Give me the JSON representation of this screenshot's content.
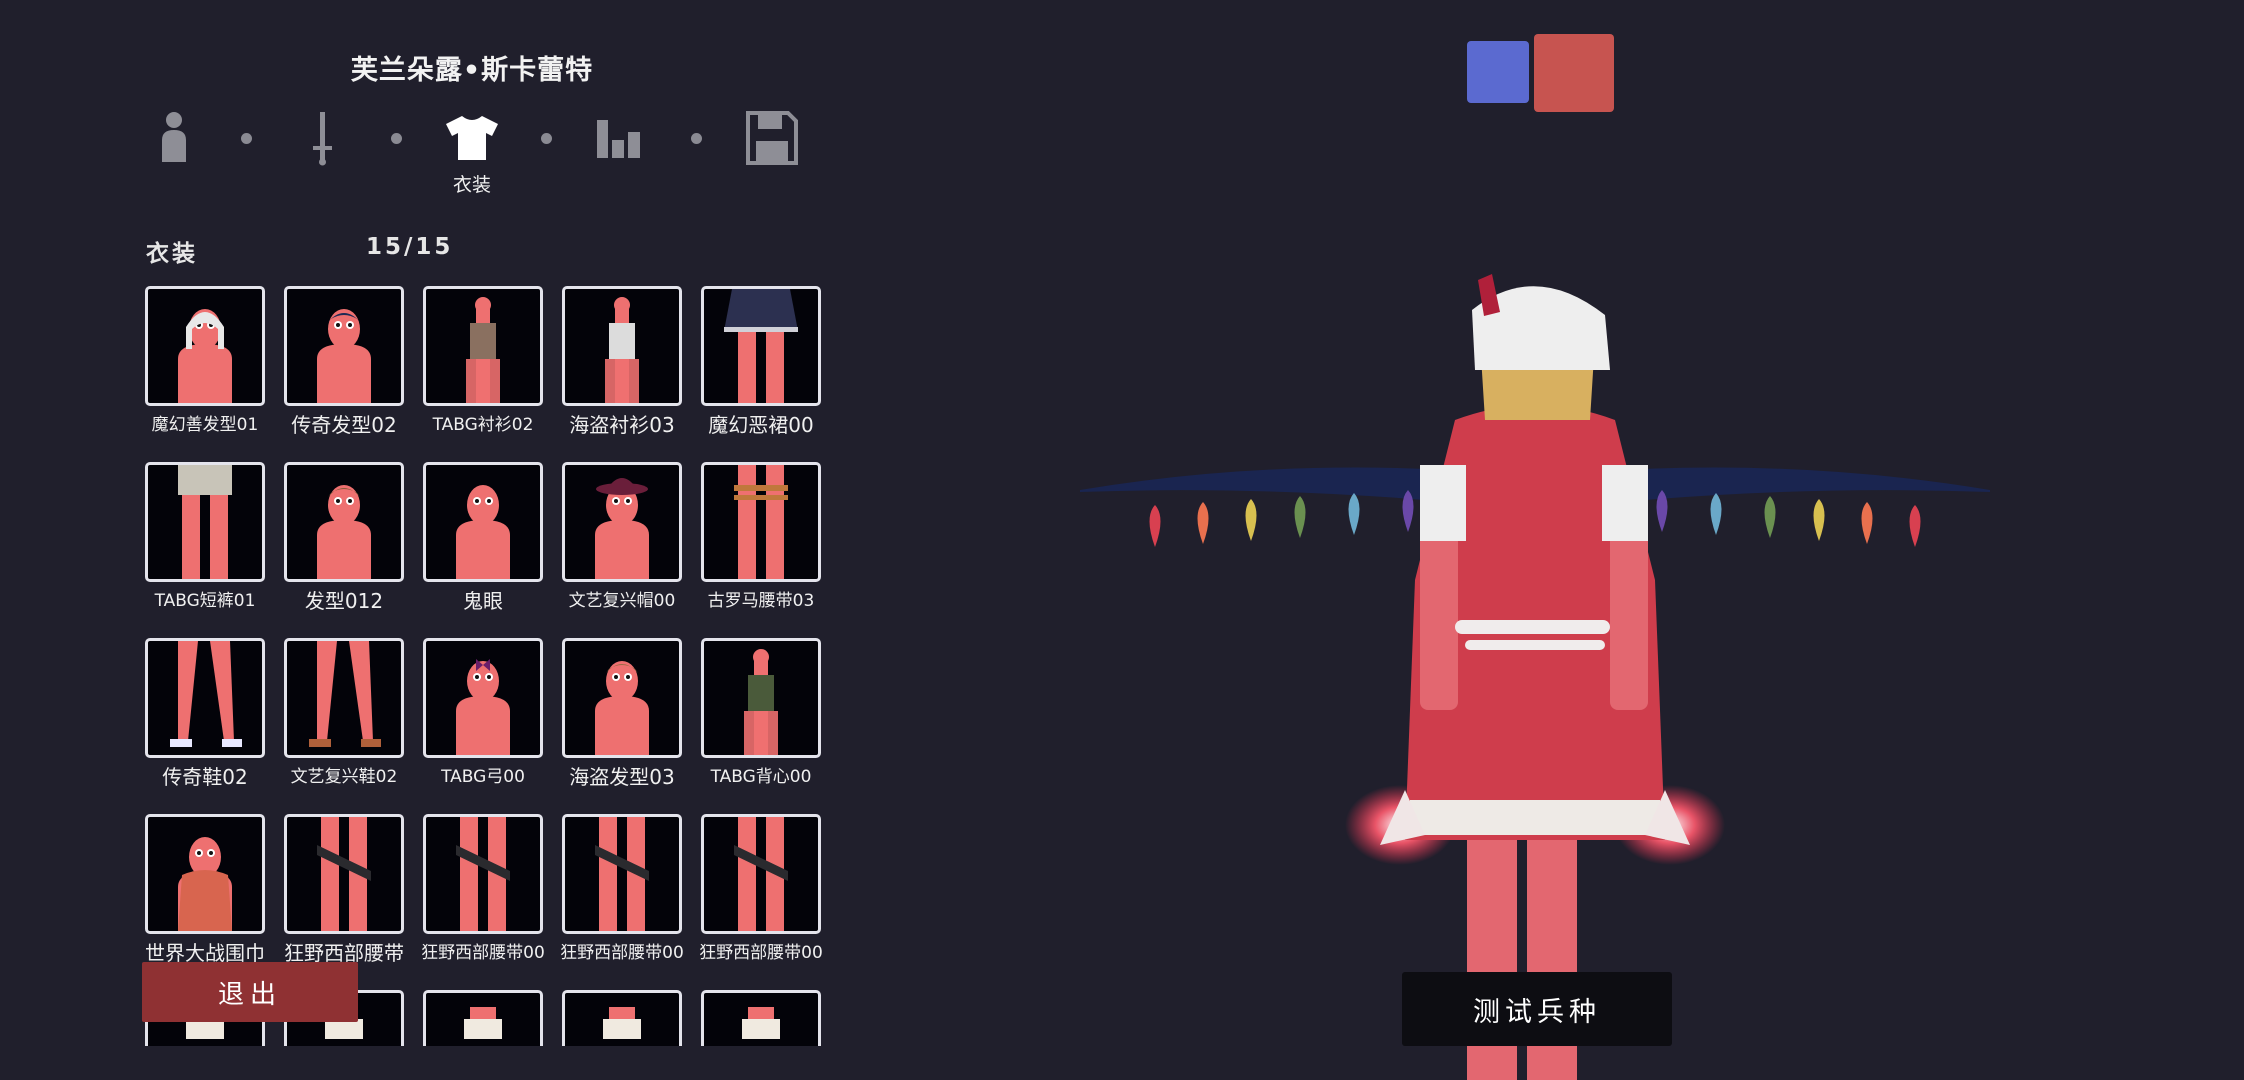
{
  "unit_name": "芙兰朵露•斯卡蕾特",
  "steps": [
    {
      "icon": "unit-icon",
      "active": false
    },
    {
      "icon": "weapon-icon",
      "active": false
    },
    {
      "icon": "clothing-icon",
      "active": true,
      "caption": "衣装"
    },
    {
      "icon": "stats-icon",
      "active": false
    },
    {
      "icon": "save-icon",
      "active": false
    }
  ],
  "category": {
    "label": "衣装",
    "count": "15/15"
  },
  "items": [
    {
      "label": "魔幻善发型01",
      "thumb": "white-hair"
    },
    {
      "label": "传奇发型02",
      "thumb": "dark-hair"
    },
    {
      "label": "TABG衬衫02",
      "thumb": "shirt-brown"
    },
    {
      "label": "海盗衬衫03",
      "thumb": "shirt-white"
    },
    {
      "label": "魔幻恶裙00",
      "thumb": "skirt"
    },
    {
      "label": "TABG短裤01",
      "thumb": "shorts"
    },
    {
      "label": "发型012",
      "thumb": "brown-hair"
    },
    {
      "label": "鬼眼",
      "thumb": "ghost-eyes"
    },
    {
      "label": "文艺复兴帽00",
      "thumb": "hat"
    },
    {
      "label": "古罗马腰带03",
      "thumb": "belt-rope"
    },
    {
      "label": "传奇鞋02",
      "thumb": "shoes-white"
    },
    {
      "label": "文艺复兴鞋02",
      "thumb": "shoes-brown"
    },
    {
      "label": "TABG弓00",
      "thumb": "bow"
    },
    {
      "label": "海盗发型03",
      "thumb": "pirate-hair"
    },
    {
      "label": "TABG背心00",
      "thumb": "vest"
    },
    {
      "label": "世界大战围巾",
      "thumb": "scarf"
    },
    {
      "label": "狂野西部腰带",
      "thumb": "belt-west"
    },
    {
      "label": "狂野西部腰带00",
      "thumb": "belt-west"
    },
    {
      "label": "狂野西部腰带00",
      "thumb": "belt-west"
    },
    {
      "label": "狂野西部腰带00",
      "thumb": "belt-west"
    },
    {
      "label": "",
      "thumb": "partial"
    },
    {
      "label": "",
      "thumb": "partial"
    },
    {
      "label": "",
      "thumb": "partial"
    },
    {
      "label": "",
      "thumb": "partial"
    },
    {
      "label": "",
      "thumb": "partial"
    }
  ],
  "exit_label": "退出",
  "test_unit_label": "测试兵种",
  "teams": [
    {
      "name": "blue-team",
      "color": "#5b6ad0"
    },
    {
      "name": "red-team",
      "color": "#c75450",
      "selected": true
    }
  ],
  "colors": {
    "background": "#201f2c",
    "skin": "#ee7070",
    "dress": "#cf3d4c",
    "exit": "#8f3133"
  }
}
